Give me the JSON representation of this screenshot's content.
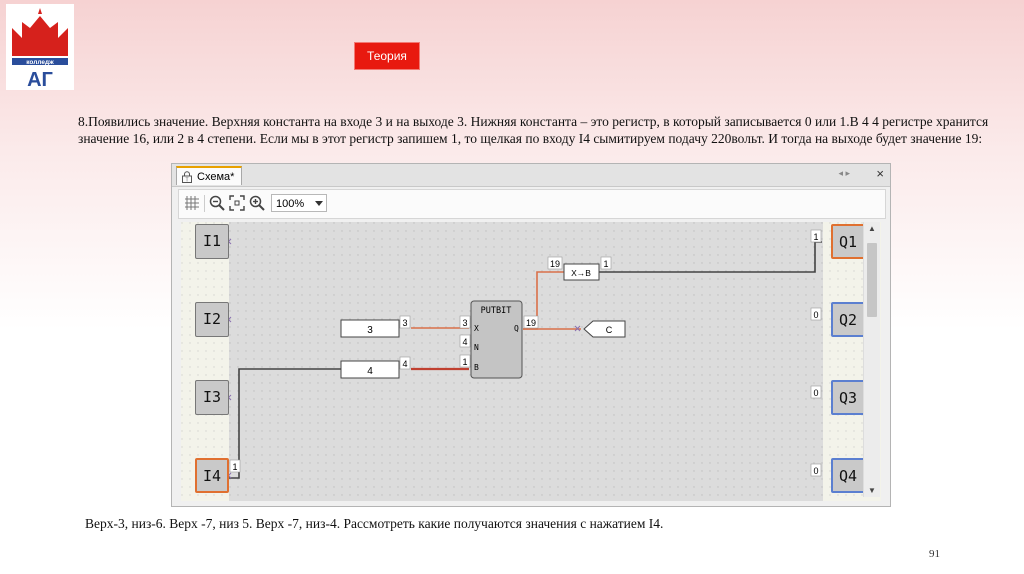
{
  "header": {
    "logo_text": "колледж",
    "logo_monogram": "АГ",
    "theory_button": "Теория"
  },
  "description": "8.Появились значение. Верхняя константа на входе 3 и на выходе 3.  Нижняя константа – это регистр, в который записывается 0 или 1.В 4 4 регистре хранится значение 16, или 2 в 4 степени. Если мы в этот регистр запишем 1, то щелкая по входу I4 сымитируем подачу 220вольт. И тогда на выходе будет значение 19:",
  "window": {
    "tab_label": "Схема*",
    "close_glyph": "×",
    "nav_arrows": "◂ ▸",
    "zoom_value": "100%"
  },
  "inputs": [
    {
      "label": "I1",
      "value": ""
    },
    {
      "label": "I2",
      "value": ""
    },
    {
      "label": "I3",
      "value": ""
    },
    {
      "label": "I4",
      "value": "1"
    }
  ],
  "outputs": [
    {
      "label": "Q1",
      "value": "1"
    },
    {
      "label": "Q2",
      "value": "0"
    },
    {
      "label": "Q3",
      "value": "0"
    },
    {
      "label": "Q4",
      "value": "0"
    }
  ],
  "blocks": {
    "const_top": {
      "text": "3",
      "out": "3"
    },
    "const_bottom": {
      "text": "4",
      "out": "4"
    },
    "putbit": {
      "title": "PUTBIT",
      "pin_x": "X",
      "pin_n": "N",
      "pin_b": "B",
      "pin_q": "Q",
      "in_x": "3",
      "in_n": "4",
      "in_b": "1",
      "out_q": "19"
    },
    "converter": {
      "text": "X→B",
      "in": "19",
      "out": "1"
    },
    "connector": {
      "text": "C"
    }
  },
  "footer_text": "Верх-3, низ-6. Верх -7, низ 5. Верх -7, низ-4. Рассмотреть какие получаются значения с нажатием I4.",
  "page_number": "91",
  "colors": {
    "accent_red": "#e8190f",
    "wire_active": "#e07030",
    "output_border": "#5b7fd0"
  }
}
